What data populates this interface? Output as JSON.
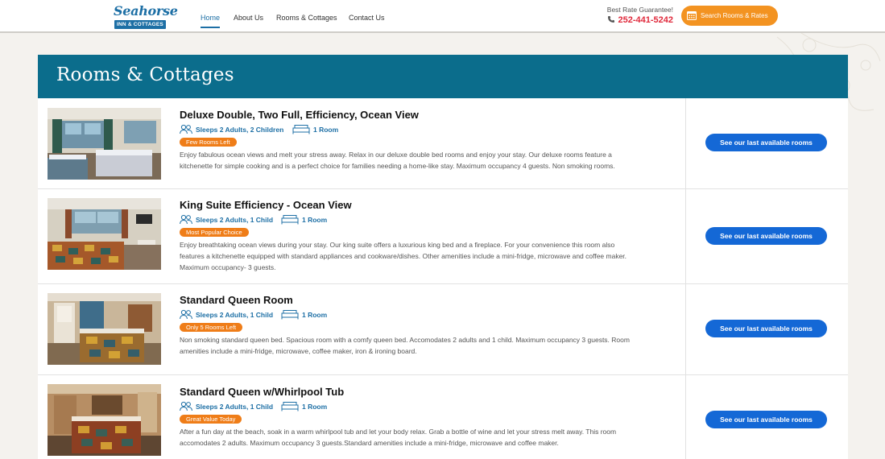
{
  "header": {
    "logo": {
      "script": "Seahorse",
      "bar": "INN & COTTAGES"
    },
    "nav": [
      {
        "label": "Home",
        "active": true
      },
      {
        "label": "About Us",
        "active": false
      },
      {
        "label": "Rooms & Cottages",
        "active": false
      },
      {
        "label": "Contact Us",
        "active": false
      }
    ],
    "rate_label": "Best Rate Guarantee!",
    "phone": "252-441-5242",
    "search_button": "Search Rooms & Rates"
  },
  "page": {
    "title": "Rooms & Cottages"
  },
  "rooms": [
    {
      "title": "Deluxe Double, Two Full, Efficiency, Ocean View",
      "sleeps": "Sleeps 2 Adults, 2 Children",
      "rooms": "1 Room",
      "badge": "Few Rooms Left",
      "description": "Enjoy fabulous ocean views and melt your stress away. Relax in our deluxe double bed rooms and enjoy your stay. Our deluxe rooms feature a kitchenette for simple cooking and is a perfect choice for families needing a home-like stay. Maximum occupancy 4 guests. Non smoking rooms.",
      "button": "See our last available rooms"
    },
    {
      "title": "King Suite Efficiency - Ocean View",
      "sleeps": "Sleeps 2 Adults, 1 Child",
      "rooms": "1 Room",
      "badge": "Most Popular Choice",
      "description": "Enjoy breathtaking ocean views during your stay. Our king suite offers a luxurious king bed and a fireplace. For your convenience this room also features a kitchenette equipped with standard appliances and cookware/dishes. Other amenities include a mini-fridge, microwave and coffee maker. Maximum occupancy- 3 guests.",
      "button": "See our last available rooms"
    },
    {
      "title": "Standard Queen Room",
      "sleeps": "Sleeps 2 Adults, 1 Child",
      "rooms": "1 Room",
      "badge": "Only 5 Rooms Left",
      "description": "Non smoking standard queen bed. Spacious room with a comfy queen bed. Accomodates 2 adults and 1 child. Maximum occupancy 3 guests. Room amenities include a mini-fridge, microwave, coffee maker, iron & ironing board.",
      "button": "See our last available rooms"
    },
    {
      "title": "Standard Queen w/Whirlpool Tub",
      "sleeps": "Sleeps 2 Adults, 1 Child",
      "rooms": "1 Room",
      "badge": "Great Value Today",
      "description": "After a fun day at the beach, soak in a warm whirlpool tub and let your body relax. Grab a bottle of wine and let your stress melt away. This room accomodates 2 adults. Maximum occupancy 3 guests.Standard amenities include a mini-fridge, microwave and coffee maker.",
      "button": "See our last available rooms"
    }
  ],
  "colors": {
    "brand_blue": "#1d6fa5",
    "panel_teal": "#0b6d8c",
    "orange": "#f39321",
    "button_blue": "#1468d6",
    "phone_red": "#e02a3c"
  }
}
